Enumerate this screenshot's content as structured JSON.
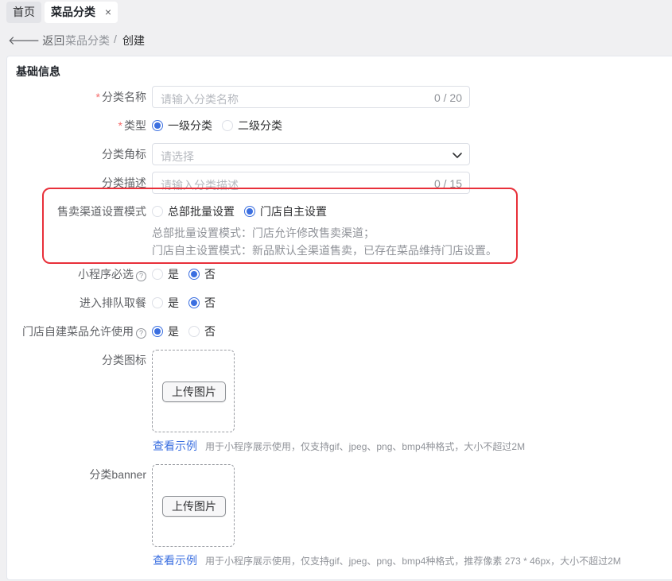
{
  "tabs": {
    "home_label": "首页",
    "active_label": "菜品分类",
    "close_glyph": "×"
  },
  "breadcrumb": {
    "back_label": "返回",
    "items": [
      "菜品分类",
      "创建"
    ],
    "separator": "/"
  },
  "form": {
    "section_title": "基础信息",
    "category_name": {
      "label": "分类名称",
      "required": true,
      "placeholder": "请输入分类名称",
      "counter": "0 / 20"
    },
    "type": {
      "label": "类型",
      "required": true,
      "options": [
        "一级分类",
        "二级分类"
      ],
      "selected": "一级分类"
    },
    "corner_mark": {
      "label": "分类角标",
      "placeholder": "请选择"
    },
    "description": {
      "label": "分类描述",
      "placeholder": "请输入分类描述",
      "counter": "0 / 15"
    },
    "sales_channel": {
      "label": "售卖渠道设置模式",
      "options": [
        "总部批量设置",
        "门店自主设置"
      ],
      "selected": "门店自主设置",
      "tips": [
        "总部批量设置模式：门店允许修改售卖渠道；",
        "门店自主设置模式：新品默认全渠道售卖，已存在菜品维持门店设置。"
      ]
    },
    "mini_program_required": {
      "label": "小程序必选",
      "help_icon": "?",
      "options": [
        "是",
        "否"
      ],
      "selected": "否"
    },
    "queue_pickup": {
      "label": "进入排队取餐",
      "options": [
        "是",
        "否"
      ],
      "selected": "否"
    },
    "store_custom_allowed": {
      "label": "门店自建菜品允许使用",
      "help_icon": "?",
      "options": [
        "是",
        "否"
      ],
      "selected": "是"
    },
    "category_icon": {
      "label": "分类图标",
      "upload_label": "上传图片",
      "example_link": "查看示例",
      "hint": "用于小程序展示使用，仅支持gif、jpeg、png、bmp4种格式，大小不超过2M"
    },
    "category_banner": {
      "label": "分类banner",
      "upload_label": "上传图片",
      "example_link": "查看示例",
      "hint": "用于小程序展示使用，仅支持gif、jpeg、png、bmp4种格式，推荐像素 273 * 46px，大小不超过2M"
    }
  },
  "colors": {
    "primary": "#3b6fe0",
    "required": "#f56c6c",
    "highlight_box": "#e8303a"
  },
  "icons": {
    "back": "arrow-left-icon",
    "select": "chevron-down-icon",
    "help": "question-circle-icon",
    "close": "close-icon"
  }
}
